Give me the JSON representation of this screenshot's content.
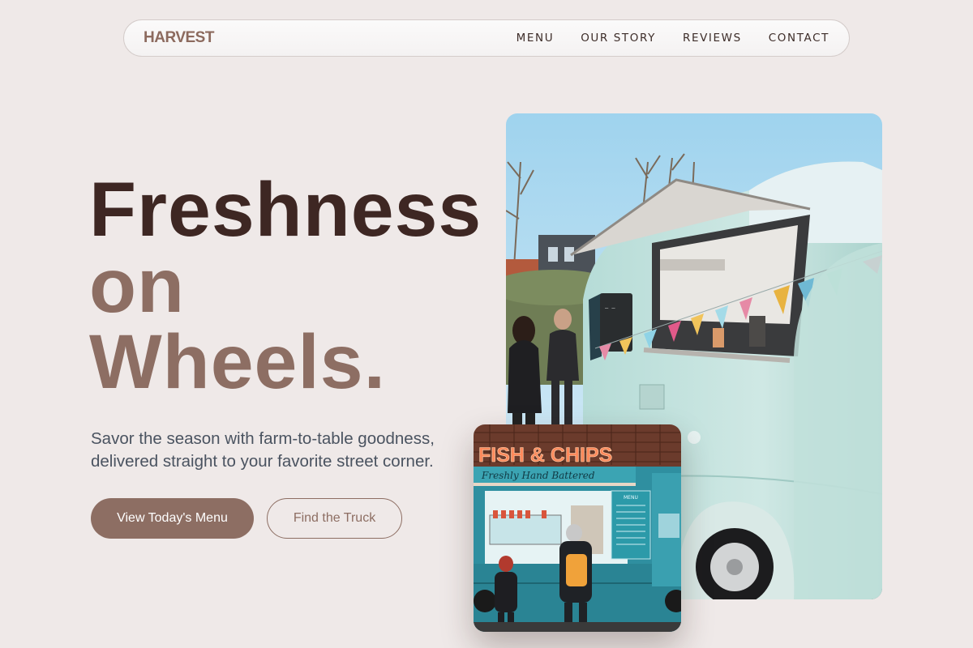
{
  "nav": {
    "logo": "HARVEST",
    "links": [
      "MENU",
      "OUR STORY",
      "REVIEWS",
      "CONTACT"
    ]
  },
  "hero": {
    "headline": [
      "Freshness",
      "on",
      "Wheels."
    ],
    "subtitle": "Savor the season with farm-to-table goodness, delivered straight to your favorite street corner.",
    "primary_button": "View Today's Menu",
    "secondary_button": "Find the Truck"
  },
  "small_photo": {
    "sign": "FISH & CHIPS",
    "tagline": "Freshly Hand Battered",
    "menu_board": "MENU"
  },
  "colors": {
    "background": "#efe9e8",
    "headline_dark": "#3e2723",
    "accent": "#8d6e63",
    "subtitle": "#4a5360"
  },
  "icons": [
    "food-truck-photo",
    "fish-chips-truck-photo"
  ]
}
